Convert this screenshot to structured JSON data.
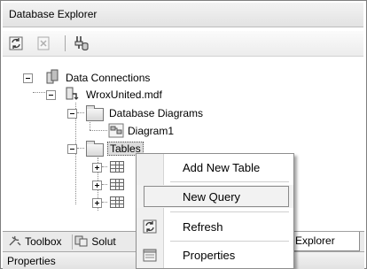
{
  "panel": {
    "title": "Database Explorer"
  },
  "toolbar": {
    "buttons": [
      {
        "name": "refresh-icon"
      },
      {
        "name": "stop-icon"
      },
      {
        "name": "connect-to-database-icon"
      }
    ]
  },
  "tree": {
    "root_label": "Data Connections",
    "db_label": "WroxUnited.mdf",
    "diagrams_label": "Database Diagrams",
    "diagram1_label": "Diagram1",
    "tables_label": "Tables"
  },
  "context_menu": {
    "items": [
      {
        "label": "Add New Table",
        "icon": ""
      },
      {
        "label": "New Query",
        "icon": "",
        "highlighted": true
      },
      {
        "label": "Refresh",
        "icon": "refresh-icon"
      },
      {
        "label": "Properties",
        "icon": "properties-icon"
      }
    ]
  },
  "bottom_tabs": {
    "toolbox": "Toolbox",
    "solution": "Solut",
    "explorer": "Explorer"
  },
  "properties_panel": {
    "title": "Properties"
  }
}
